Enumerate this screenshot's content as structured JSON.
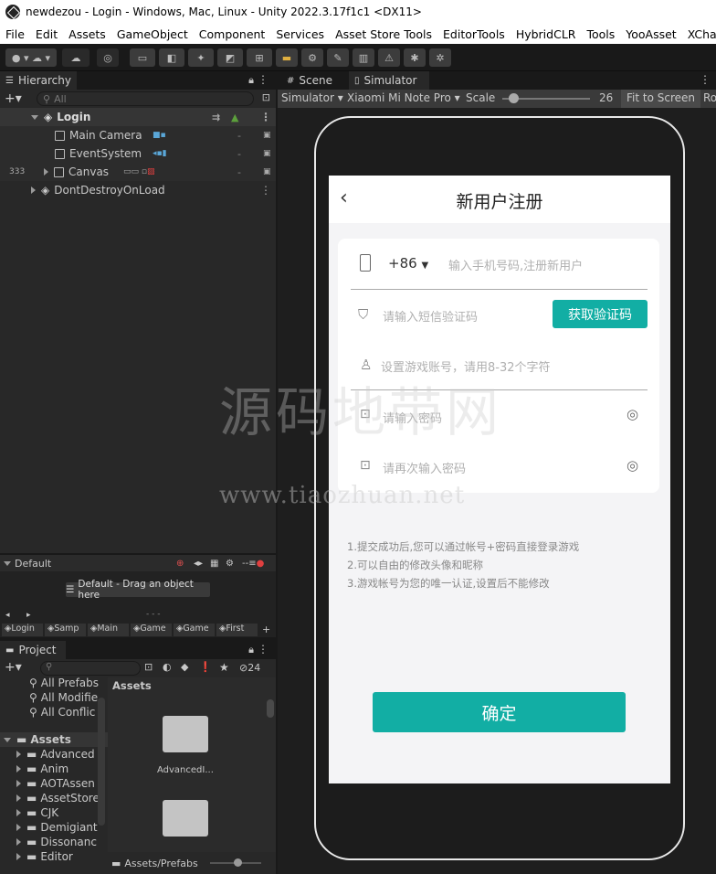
{
  "window": {
    "title": "newdezou - Login - Windows, Mac, Linux - Unity 2022.3.17f1c1 <DX11>"
  },
  "menu": [
    "File",
    "Edit",
    "Assets",
    "GameObject",
    "Component",
    "Services",
    "Asset Store Tools",
    "EditorTools",
    "HybridCLR",
    "Tools",
    "YooAsset",
    "XCharts"
  ],
  "hierarchy": {
    "tab": "Hierarchy",
    "search_placeholder": "All",
    "scene": "Login",
    "items": [
      {
        "label": "Main Camera"
      },
      {
        "label": "EventSystem"
      },
      {
        "label": "Canvas",
        "count": "333"
      }
    ],
    "ddol": "DontDestroyOnLoad"
  },
  "animator": {
    "layer": "Default",
    "drop_hint": "Default - Drag an object here",
    "dashes": "- - -",
    "tabs": [
      "Login",
      "Samp",
      "Main",
      "Game",
      "Game",
      "First"
    ]
  },
  "project": {
    "tab": "Project",
    "hidden_count": "24",
    "favorites": [
      "All Prefabs",
      "All Modifie",
      "All Conflic"
    ],
    "root": "Assets",
    "folders": [
      "Advanced",
      "Anim",
      "AOTAssen",
      "AssetStore",
      "CJK",
      "Demigiant",
      "Dissonanc",
      "Editor"
    ],
    "content_header": "Assets",
    "assets": [
      "AdvancedI..."
    ],
    "path": "Assets/Prefabs"
  },
  "scene_view": {
    "tabs": [
      "Scene",
      "Simulator"
    ],
    "mode": "Simulator",
    "device": "Xiaomi Mi Note Pro",
    "scale_label": "Scale",
    "scale_value": "26",
    "scale_fraction": 0.12,
    "fit": "Fit to Screen",
    "extra": "Ro"
  },
  "app": {
    "header_title": "新用户注册",
    "country_code": "+86",
    "phone_placeholder": "输入手机号码,注册新用户",
    "sms_placeholder": "请输入短信验证码",
    "get_code": "获取验证码",
    "account_placeholder": "设置游戏账号，请用8-32个字符",
    "password_placeholder": "请输入密码",
    "password2_placeholder": "请再次输入密码",
    "notes": [
      "1.提交成功后,您可以通过帐号+密码直接登录游戏",
      "2.可以自由的修改头像和昵称",
      "3.游戏帐号为您的唯一认证,设置后不能修改"
    ],
    "confirm": "确定"
  },
  "watermark": {
    "cn": "源码地带网",
    "url": "www.tiaozhuan.net"
  },
  "colors": {
    "accent": "#12aea4",
    "editor_bg": "#282828",
    "selection": "#2c5d87"
  }
}
